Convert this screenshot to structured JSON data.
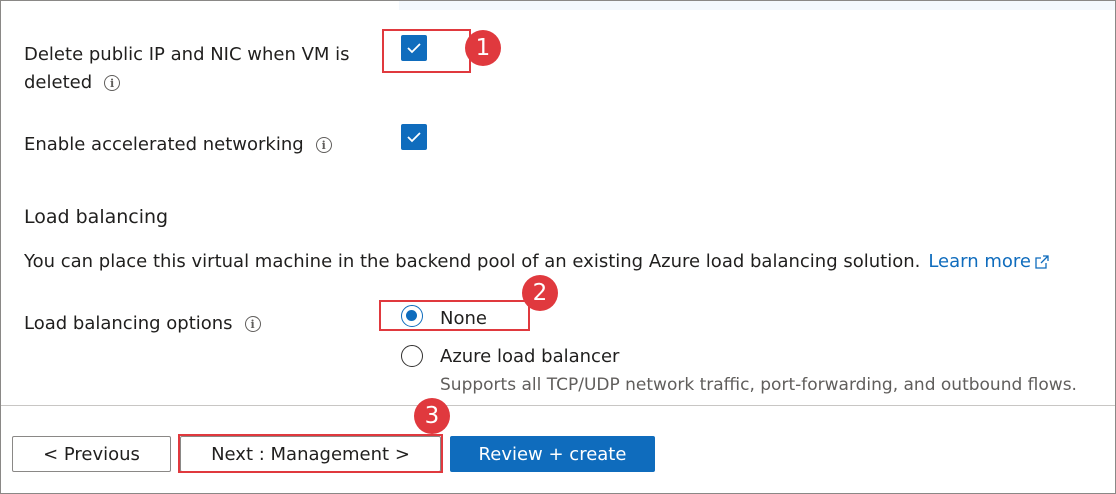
{
  "networking": {
    "delete_ip_nic": {
      "label_line1": "Delete public IP and NIC when VM is",
      "label_line2": "deleted",
      "checked": true,
      "info_icon": "info-icon"
    },
    "accelerated_networking": {
      "label": "Enable accelerated networking",
      "checked": true,
      "info_icon": "info-icon"
    }
  },
  "load_balancing": {
    "section_title": "Load balancing",
    "description": "You can place this virtual machine in the backend pool of an existing Azure load balancing solution.",
    "learn_more": "Learn more",
    "learn_more_icon": "external-link-icon",
    "options_label": "Load balancing options",
    "options": [
      {
        "label": "None",
        "selected": true,
        "sublabel": ""
      },
      {
        "label": "Azure load balancer",
        "selected": false,
        "sublabel": "Supports all TCP/UDP network traffic, port-forwarding, and outbound flows."
      }
    ]
  },
  "footer": {
    "previous": "< Previous",
    "next": "Next : Management >",
    "review_create": "Review + create"
  },
  "annotations": {
    "markers": [
      "1",
      "2",
      "3"
    ],
    "color": "#e0393e"
  },
  "colors": {
    "accent": "#0f6cbd",
    "link": "#0f6cbd",
    "text": "#201f1e",
    "muted": "#605e5c"
  }
}
